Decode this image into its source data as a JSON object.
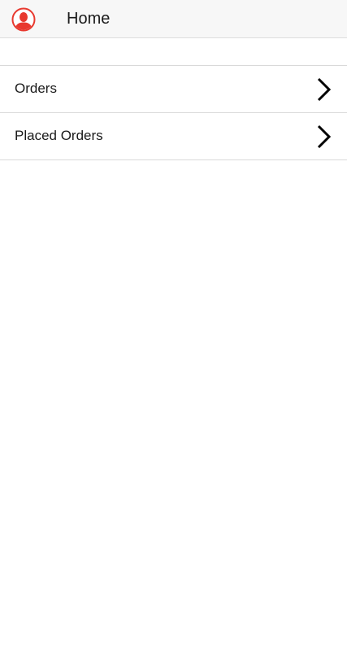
{
  "header": {
    "title": "Home",
    "avatar_icon": "user-avatar-icon",
    "avatar_color": "#e8392f"
  },
  "menu": {
    "items": [
      {
        "label": "Orders",
        "icon": "chevron-right-icon"
      },
      {
        "label": "Placed Orders",
        "icon": "chevron-right-icon"
      }
    ]
  }
}
